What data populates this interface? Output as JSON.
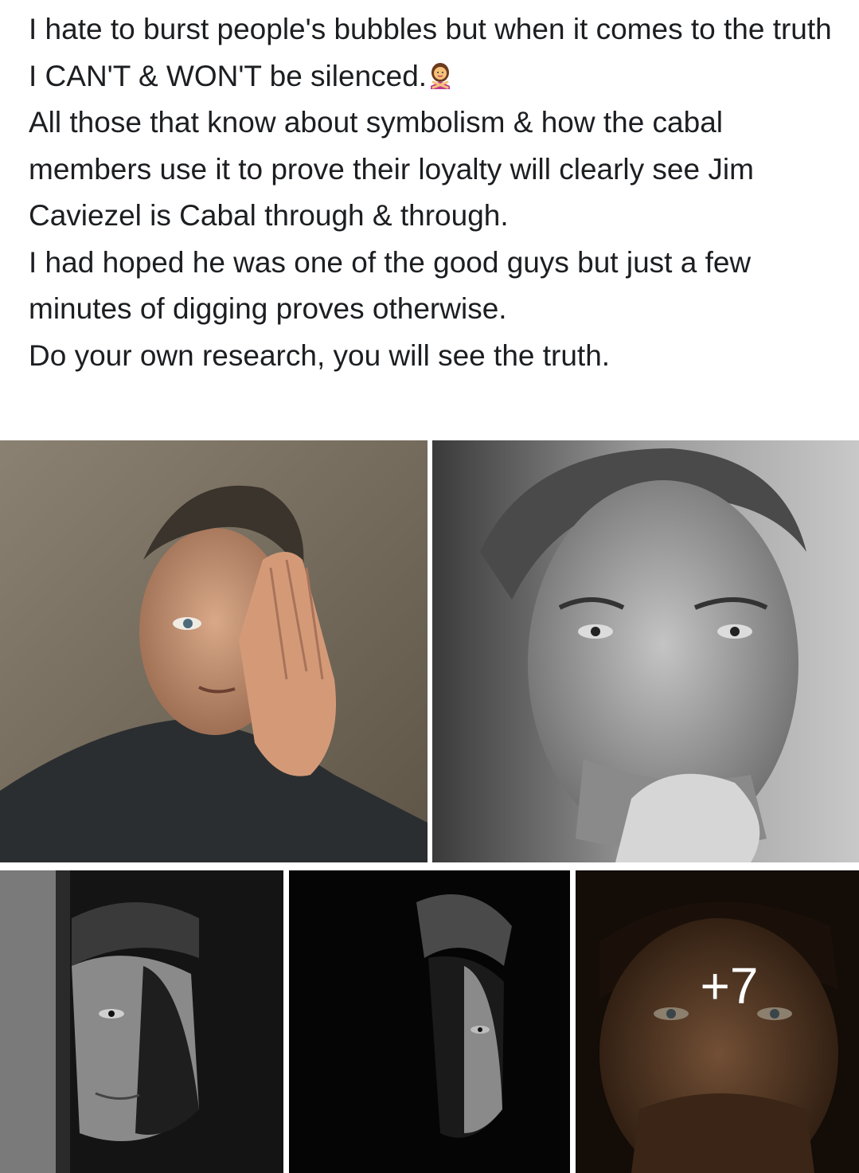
{
  "post": {
    "lines": [
      "I hate to burst people's bubbles but when it comes to the truth I CAN'T & WON'T be silenced.",
      "All those that know about symbolism & how the cabal members use it to prove their loyalty will clearly see Jim Caviezel is Cabal through & through.",
      "I had hoped he was one of the good guys but just a few minutes of digging proves otherwise.",
      "Do your own research, you will see the truth."
    ],
    "emoji": "woman-gesturing-no-icon"
  },
  "photos": {
    "more_count": "+7"
  },
  "colors": {
    "text": "#1c1e21",
    "background": "#ffffff",
    "overlay": "rgba(0,0,0,0.35)"
  }
}
